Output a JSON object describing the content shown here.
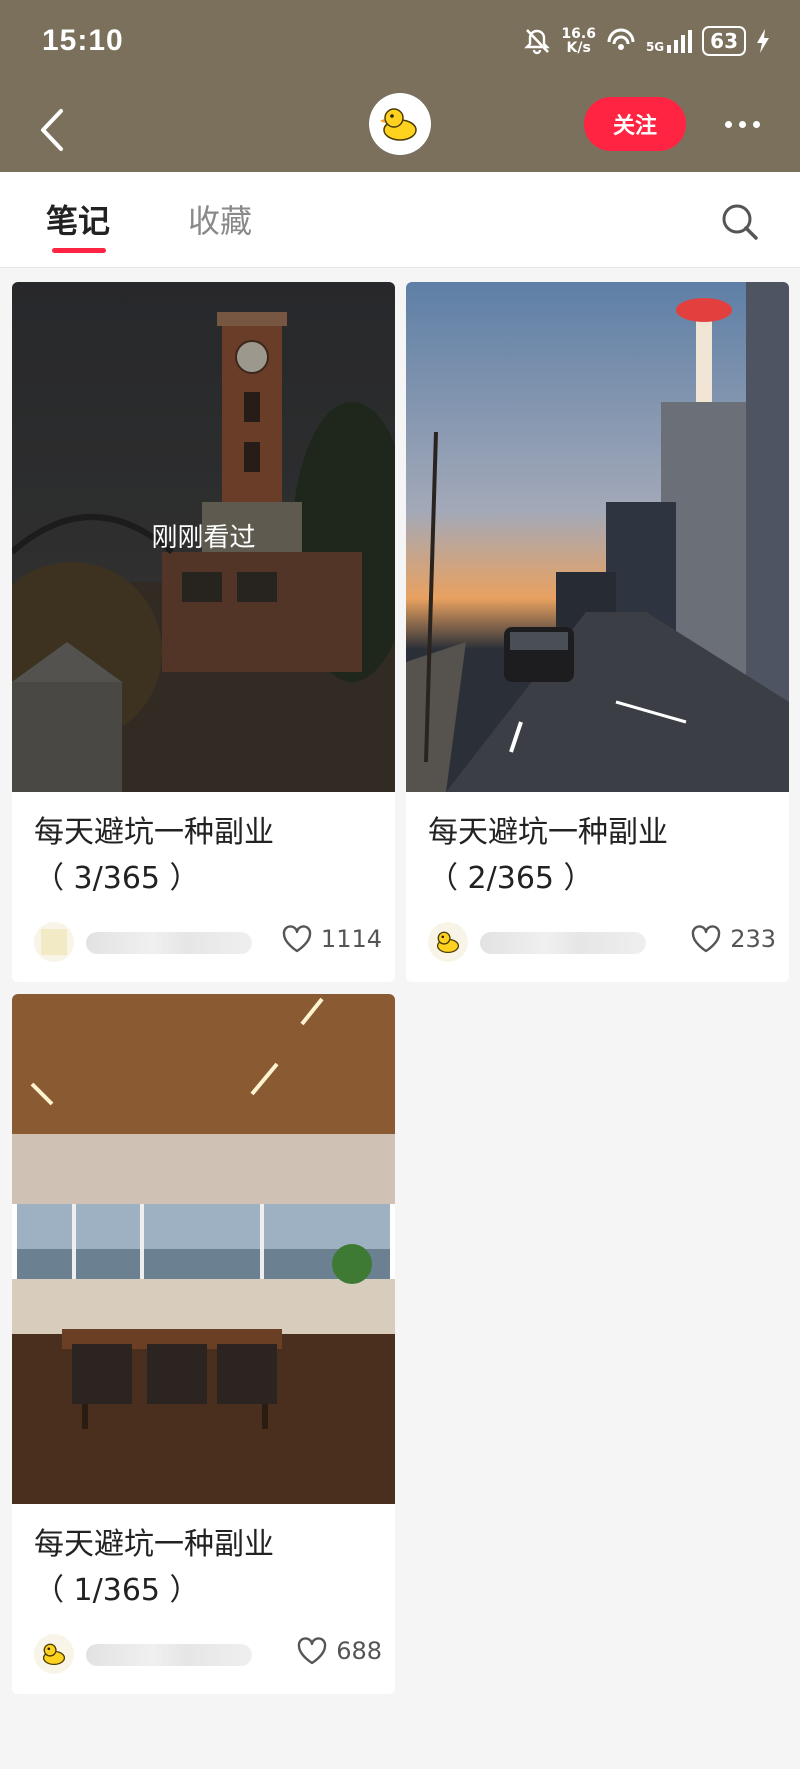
{
  "status_bar": {
    "time": "15:10",
    "net_speed_top": "16.6",
    "net_speed_bottom": "K/s",
    "signal_label": "5G",
    "battery": "63"
  },
  "nav": {
    "follow_label": "关注"
  },
  "tabs": [
    {
      "label": "笔记",
      "active": true
    },
    {
      "label": "收藏",
      "active": false
    }
  ],
  "notes": [
    {
      "title_line1": "每天避坑一种副业",
      "title_line2": "（ 3/365 ）",
      "likes": "1114",
      "badge": "刚刚看过"
    },
    {
      "title_line1": "每天避坑一种副业",
      "title_line2": "（ 2/365 ）",
      "likes": "233"
    },
    {
      "title_line1": "每天避坑一种副业",
      "title_line2": "（ 1/365 ）",
      "likes": "688"
    }
  ],
  "colors": {
    "header_bg": "#7b705b",
    "accent": "#ff2442"
  },
  "icons": [
    "back-arrow-icon",
    "duck-avatar-icon",
    "more-dots-icon",
    "search-icon",
    "heart-icon",
    "mute-bell-icon",
    "wifi-icon",
    "signal-icon",
    "charging-icon"
  ]
}
